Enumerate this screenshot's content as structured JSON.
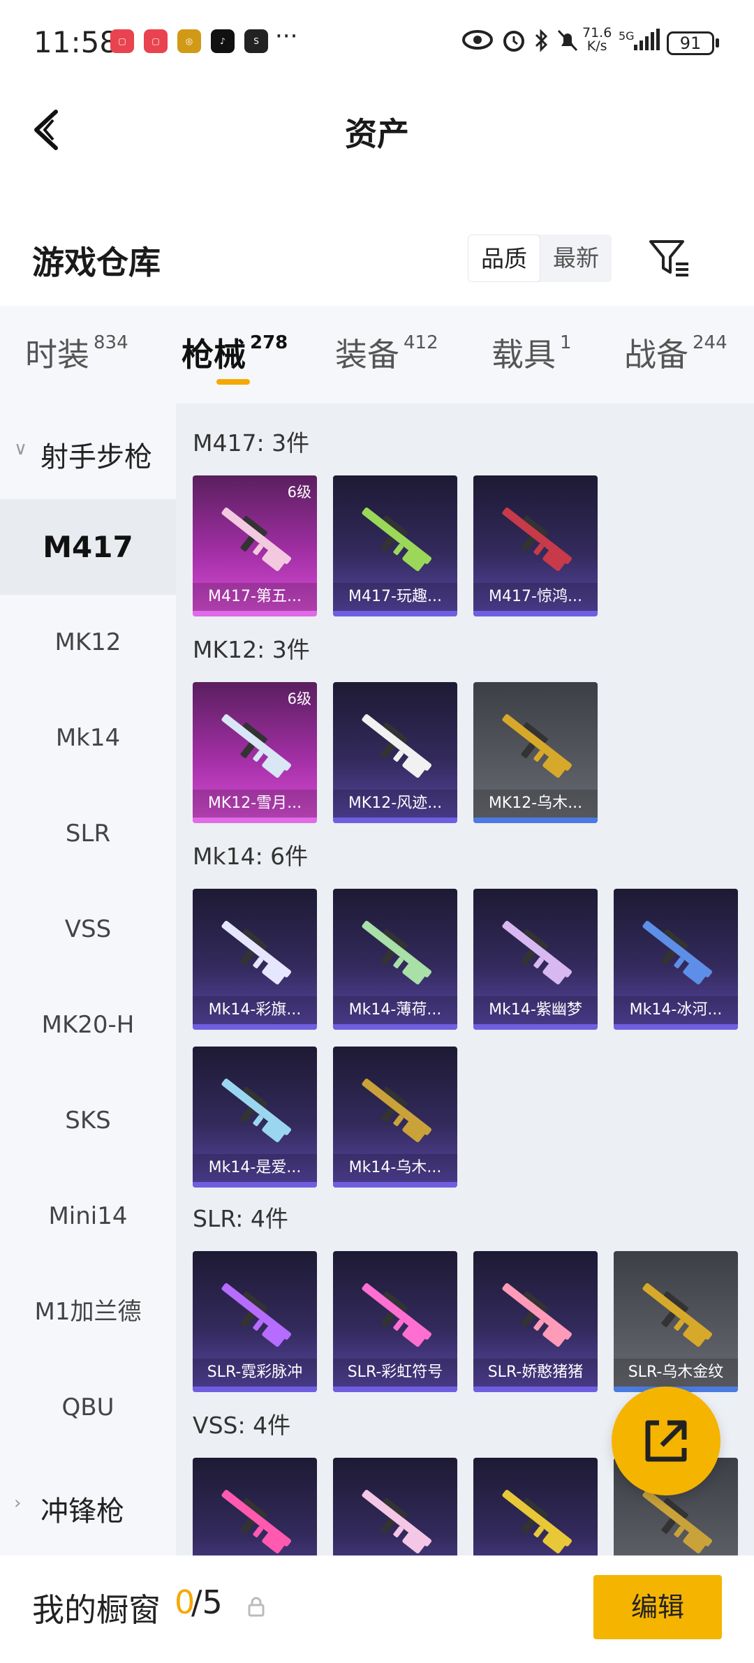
{
  "status_bar": {
    "time": "11:58",
    "more": "···",
    "net_speed_value": "71.6",
    "net_speed_unit": "K/s",
    "network": "5G",
    "battery": "91"
  },
  "header": {
    "title": "资产"
  },
  "warehouse": {
    "title": "游戏仓库",
    "sort_options": [
      "品质",
      "最新"
    ],
    "active_sort": "品质"
  },
  "tabs": [
    {
      "label": "时装",
      "count": "834"
    },
    {
      "label": "枪械",
      "count": "278"
    },
    {
      "label": "装备",
      "count": "412"
    },
    {
      "label": "载具",
      "count": "1"
    },
    {
      "label": "战备",
      "count": "244"
    }
  ],
  "sidebar": {
    "group_open": "射手步枪",
    "items": [
      "M417",
      "MK12",
      "Mk14",
      "SLR",
      "VSS",
      "MK20-H",
      "SKS",
      "Mini14",
      "M1加兰德",
      "QBU"
    ],
    "group_closed": "冲锋枪"
  },
  "sections": [
    {
      "title": "M417: 3件",
      "items": [
        {
          "name": "M417-第五...",
          "level": "6级",
          "rarity": "pink"
        },
        {
          "name": "M417-玩趣...",
          "rarity": "purple"
        },
        {
          "name": "M417-惊鸿...",
          "rarity": "purple"
        }
      ]
    },
    {
      "title": "MK12: 3件",
      "items": [
        {
          "name": "MK12-雪月...",
          "level": "6级",
          "rarity": "pink"
        },
        {
          "name": "MK12-风迹...",
          "rarity": "purple"
        },
        {
          "name": "MK12-乌木...",
          "rarity": "gray"
        }
      ]
    },
    {
      "title": "Mk14: 6件",
      "items": [
        {
          "name": "Mk14-彩旗...",
          "rarity": "purple"
        },
        {
          "name": "Mk14-薄荷...",
          "rarity": "purple"
        },
        {
          "name": "Mk14-紫幽梦",
          "rarity": "purple"
        },
        {
          "name": "Mk14-冰河...",
          "rarity": "purple"
        },
        {
          "name": "Mk14-是爱...",
          "rarity": "purple"
        },
        {
          "name": "Mk14-乌木...",
          "rarity": "purple"
        }
      ]
    },
    {
      "title": "SLR: 4件",
      "items": [
        {
          "name": "SLR-霓彩脉冲",
          "rarity": "purple"
        },
        {
          "name": "SLR-彩虹符号",
          "rarity": "purple"
        },
        {
          "name": "SLR-娇憨猪猪",
          "rarity": "purple"
        },
        {
          "name": "SLR-乌木金纹",
          "rarity": "gray"
        }
      ]
    },
    {
      "title": "VSS: 4件",
      "items": [
        {
          "name": "",
          "rarity": "purple"
        },
        {
          "name": "",
          "rarity": "purple"
        },
        {
          "name": "",
          "rarity": "purple"
        },
        {
          "name": "",
          "rarity": "gray"
        }
      ]
    }
  ],
  "bottom": {
    "label": "我的橱窗",
    "used": "0",
    "total": "5",
    "edit_label": "编辑"
  },
  "colors": {
    "accent": "#f5b400",
    "rarity_pink": "#d94fd6",
    "rarity_purple": "#5a48a8",
    "rarity_gray": "#6a6c73"
  }
}
